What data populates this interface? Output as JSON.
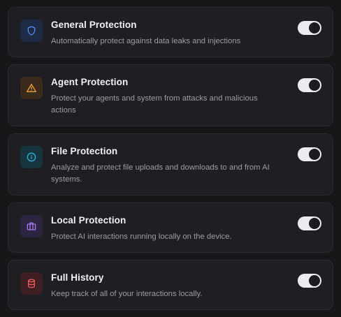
{
  "settings": {
    "items": [
      {
        "title": "General Protection",
        "description": "Automatically protect against data leaks and injections",
        "icon": "shield-icon",
        "icon_color": "#4f8ff7",
        "icon_bg": "#1f2a44",
        "enabled": true
      },
      {
        "title": "Agent Protection",
        "description": "Protect your agents and system from attacks and malicious actions",
        "icon": "warning-triangle-icon",
        "icon_color": "#f0a030",
        "icon_bg": "#3a2a1c",
        "enabled": true
      },
      {
        "title": "File Protection",
        "description": "Analyze and protect file uploads and downloads to and from AI systems.",
        "icon": "info-circle-icon",
        "icon_color": "#1fb5d6",
        "icon_bg": "#15343e",
        "enabled": true
      },
      {
        "title": "Local Protection",
        "description": "Protect AI interactions running locally on the device.",
        "icon": "briefcase-icon",
        "icon_color": "#a678f0",
        "icon_bg": "#2d2440",
        "enabled": true
      },
      {
        "title": "Full History",
        "description": "Keep track of all of your interactions locally.",
        "icon": "database-icon",
        "icon_color": "#ee5a5a",
        "icon_bg": "#3e2024",
        "enabled": true
      }
    ]
  }
}
